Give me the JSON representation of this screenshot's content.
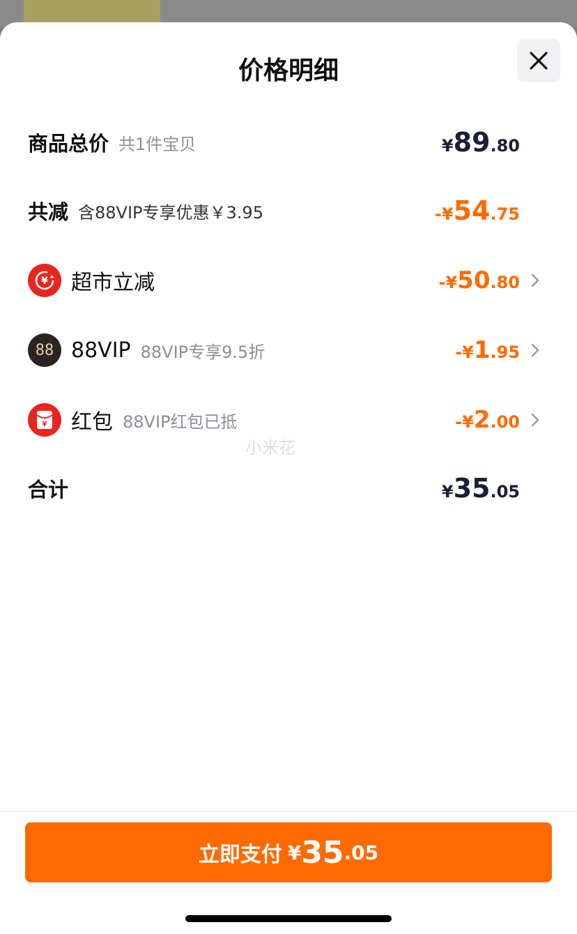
{
  "sheet": {
    "title": "价格明细",
    "close_icon": "close-icon"
  },
  "rows": {
    "total": {
      "label": "商品总价",
      "sub": "共1件宝贝",
      "currency": "¥",
      "int": "89",
      "dec": ".80"
    },
    "discount": {
      "label": "共减",
      "sub": "含88VIP专享优惠￥3.95",
      "currency": "-¥",
      "int": "54",
      "dec": ".75"
    },
    "supermarket": {
      "label": "超市立减",
      "icon": "yuan-discount-icon",
      "currency": "-¥",
      "int": "50",
      "dec": ".80"
    },
    "vip": {
      "label": "88VIP",
      "sub": "88VIP专享9.5折",
      "icon": "88vip-icon",
      "icon_text": "88",
      "currency": "-¥",
      "int": "1",
      "dec": ".95"
    },
    "red_packet": {
      "label": "红包",
      "sub": "88VIP红包已抵",
      "icon": "red-packet-icon",
      "currency": "-¥",
      "int": "2",
      "dec": ".00"
    },
    "sum": {
      "label": "合计",
      "currency": "¥",
      "int": "35",
      "dec": ".05"
    }
  },
  "watermark": "小米花",
  "pay_button": {
    "label": "立即支付",
    "currency": "¥",
    "int": "35",
    "dec": ".05"
  },
  "colors": {
    "accent": "#ff6a00",
    "text_dark": "#1a1f36",
    "red_icon": "#e8251f"
  }
}
